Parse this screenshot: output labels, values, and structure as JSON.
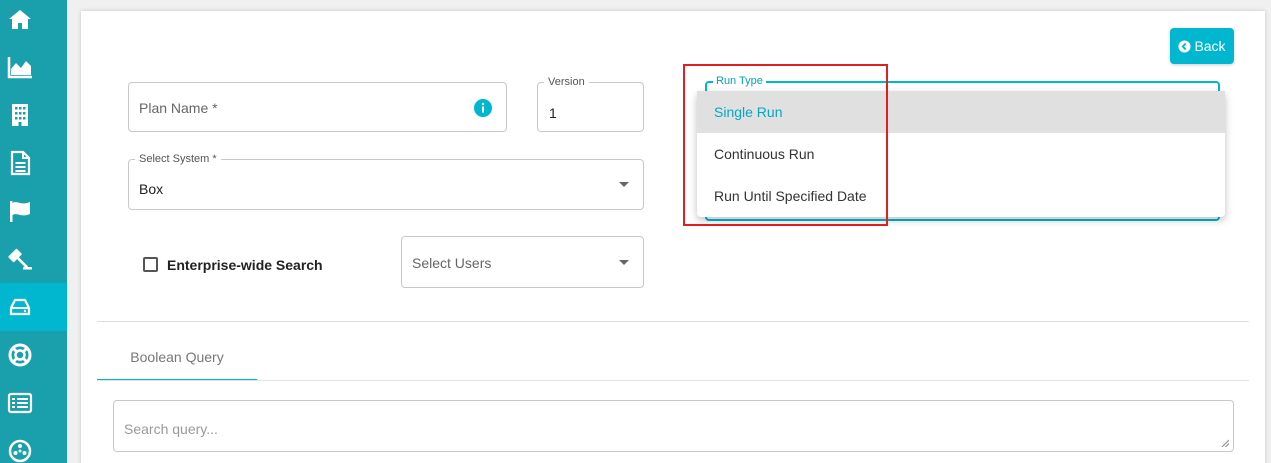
{
  "sidebar": {
    "items": [
      {
        "icon": "home-icon"
      },
      {
        "icon": "area-chart-icon"
      },
      {
        "icon": "building-icon"
      },
      {
        "icon": "document-icon"
      },
      {
        "icon": "flag-icon"
      },
      {
        "icon": "gavel-icon"
      },
      {
        "icon": "hard-drive-icon",
        "active": true
      },
      {
        "icon": "life-ring-icon"
      },
      {
        "icon": "list-icon"
      },
      {
        "icon": "network-icon"
      }
    ],
    "bg_color": "#1a9fac",
    "active_color": "#00b7cf"
  },
  "header": {
    "back_label": "Back"
  },
  "form": {
    "plan_name_placeholder": "Plan Name *",
    "version_label": "Version",
    "version_value": "1",
    "system_label": "Select System *",
    "system_value": "Box",
    "enterprise_search_label": "Enterprise-wide Search",
    "select_users_placeholder": "Select Users",
    "run_type_label": "Run Type"
  },
  "run_type_menu": {
    "options": [
      "Single Run",
      "Continuous Run",
      "Run Until Specified Date"
    ],
    "selected": "Single Run"
  },
  "tabs": [
    {
      "label": "Boolean Query",
      "active": true
    }
  ],
  "query": {
    "placeholder": "Search query..."
  },
  "colors": {
    "accent": "#00b7d0",
    "highlight": "#e02020"
  }
}
